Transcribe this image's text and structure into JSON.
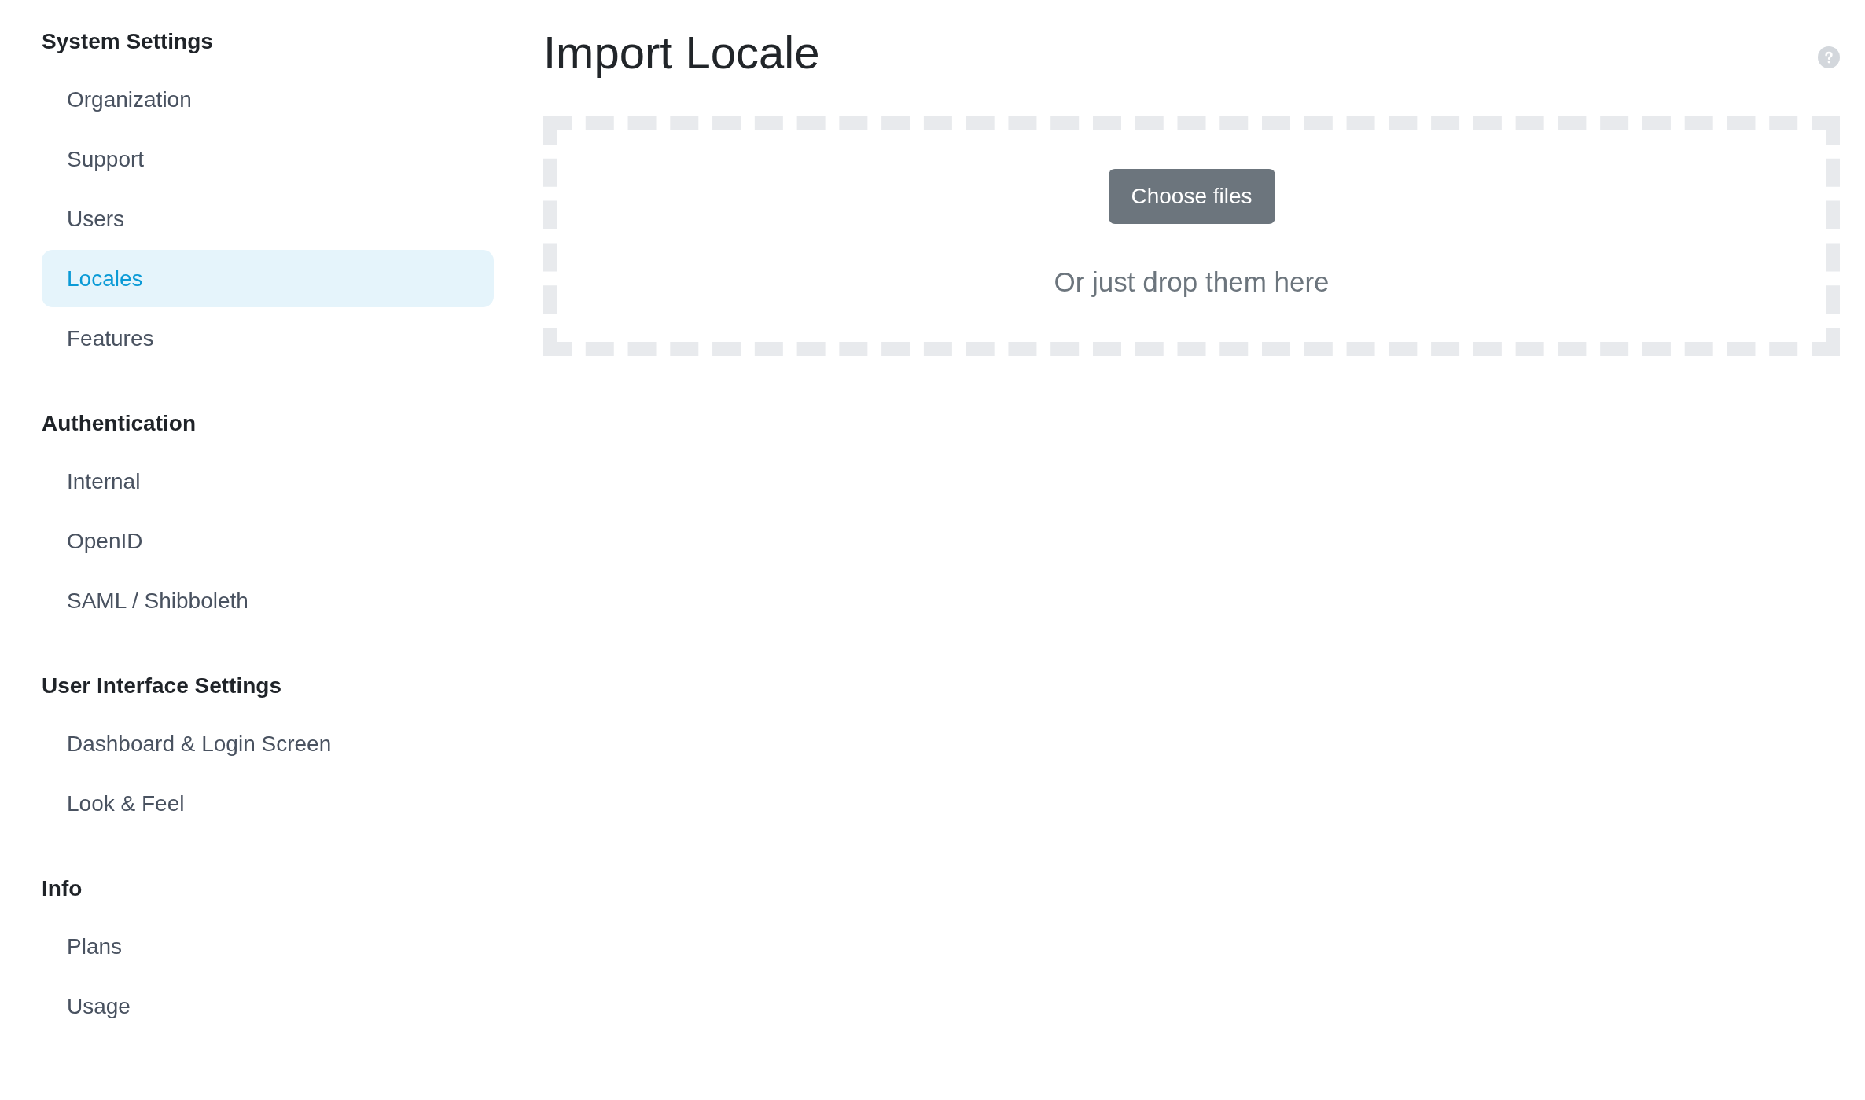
{
  "sidebar": {
    "sections": [
      {
        "heading": "System Settings",
        "items": [
          {
            "label": "Organization",
            "selected": false
          },
          {
            "label": "Support",
            "selected": false
          },
          {
            "label": "Users",
            "selected": false
          },
          {
            "label": "Locales",
            "selected": true
          },
          {
            "label": "Features",
            "selected": false
          }
        ]
      },
      {
        "heading": "Authentication",
        "items": [
          {
            "label": "Internal",
            "selected": false
          },
          {
            "label": "OpenID",
            "selected": false
          },
          {
            "label": "SAML / Shibboleth",
            "selected": false
          }
        ]
      },
      {
        "heading": "User Interface Settings",
        "items": [
          {
            "label": "Dashboard & Login Screen",
            "selected": false
          },
          {
            "label": "Look & Feel",
            "selected": false
          }
        ]
      },
      {
        "heading": "Info",
        "items": [
          {
            "label": "Plans",
            "selected": false
          },
          {
            "label": "Usage",
            "selected": false
          }
        ]
      }
    ]
  },
  "main": {
    "title": "Import Locale",
    "dropzone": {
      "button": "Choose files",
      "hint": "Or just drop them here"
    }
  }
}
